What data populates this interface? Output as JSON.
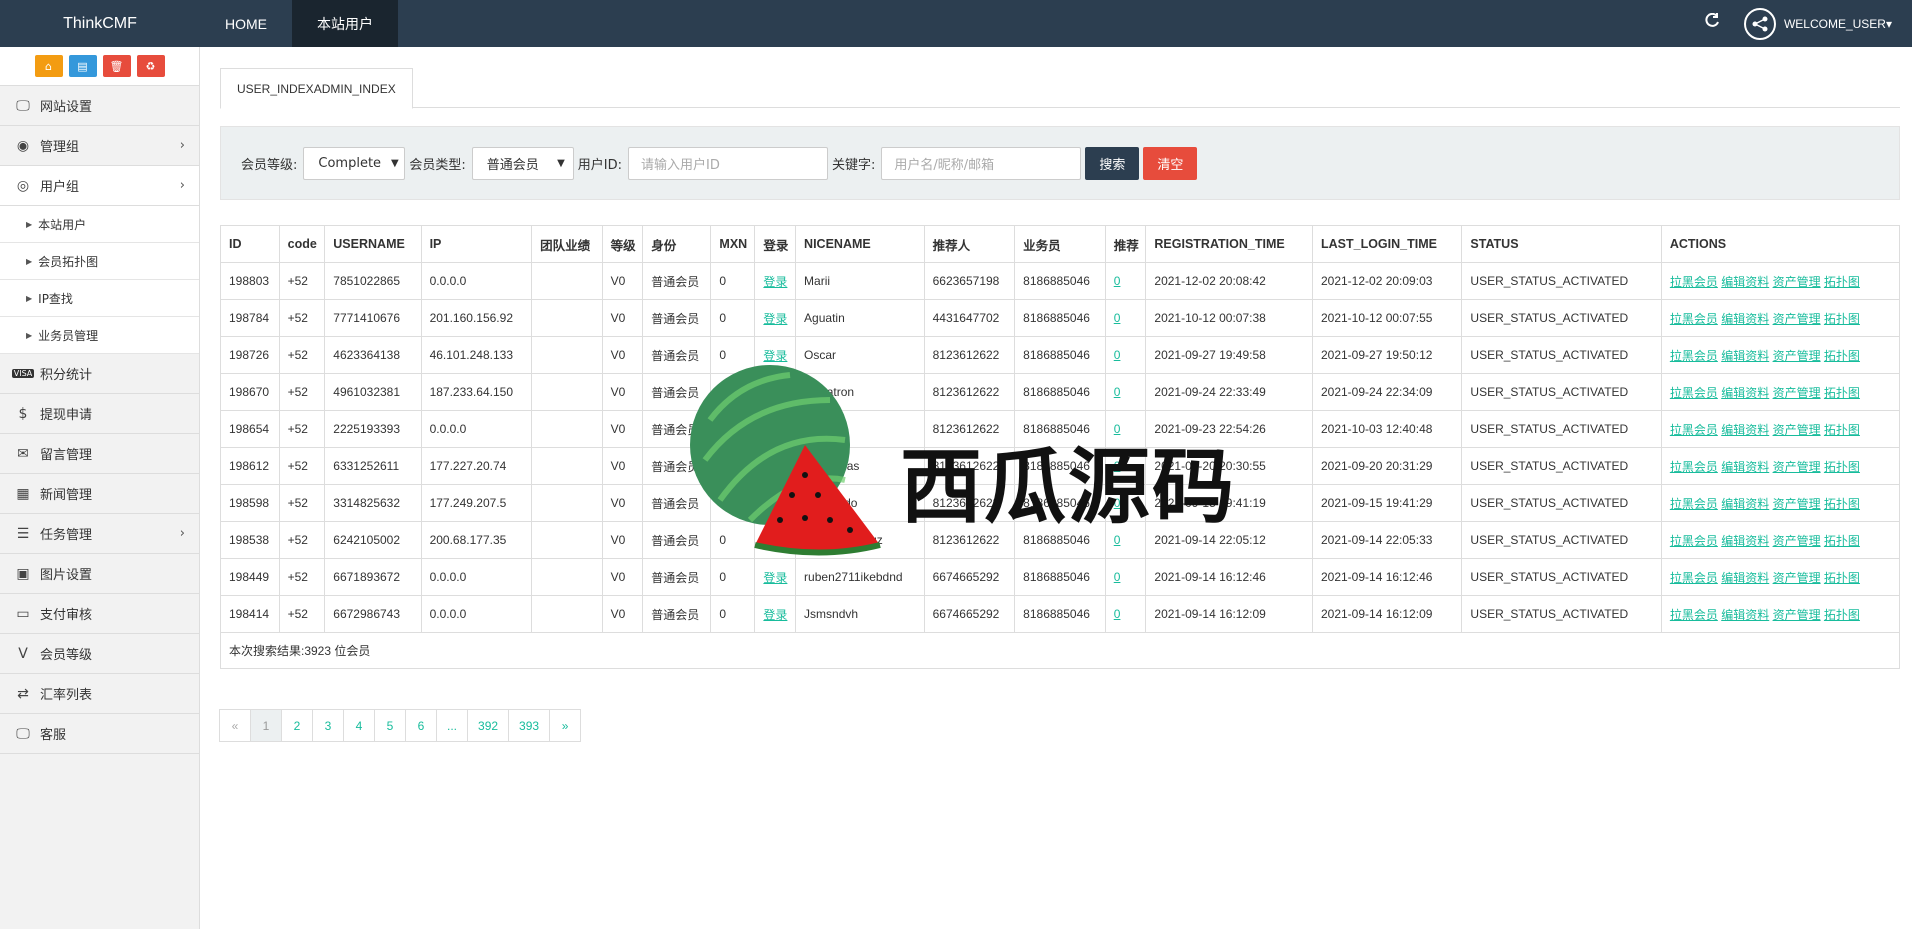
{
  "topbar": {
    "brand": "ThinkCMF",
    "nav": [
      {
        "label": "HOME",
        "active": false
      },
      {
        "label": "本站用户",
        "active": true
      }
    ],
    "refresh_icon": "refresh-icon",
    "welcome": "WELCOME_USER▾"
  },
  "sidebar": {
    "quick": [
      "home-icon",
      "file-icon",
      "trash-icon",
      "recycle-icon"
    ],
    "items": [
      {
        "label": "网站设置",
        "icon": "monitor-icon"
      },
      {
        "label": "管理组",
        "icon": "user-circle-icon",
        "chevron": true
      },
      {
        "label": "用户组",
        "icon": "user-outline-icon",
        "chevron": true,
        "open": true
      },
      {
        "label": "积分统计",
        "icon": "visa-icon"
      },
      {
        "label": "提现申请",
        "icon": "dollar-icon"
      },
      {
        "label": "留言管理",
        "icon": "envelope-icon"
      },
      {
        "label": "新闻管理",
        "icon": "newspaper-icon"
      },
      {
        "label": "任务管理",
        "icon": "tasks-icon",
        "chevron": true
      },
      {
        "label": "图片设置",
        "icon": "image-icon"
      },
      {
        "label": "支付审核",
        "icon": "id-card-icon"
      },
      {
        "label": "会员等级",
        "icon": "vine-icon"
      },
      {
        "label": "汇率列表",
        "icon": "exchange-icon"
      },
      {
        "label": "客服",
        "icon": "desktop-icon"
      }
    ],
    "subitems": [
      "本站用户",
      "会员拓扑图",
      "IP查找",
      "业务员管理"
    ]
  },
  "main": {
    "tab": "USER_INDEXADMIN_INDEX",
    "filter": {
      "level_label": "会员等级:",
      "level_value": "Complete",
      "type_label": "会员类型:",
      "type_value": "普通会员",
      "uid_label": "用户ID:",
      "uid_placeholder": "请输入用户ID",
      "keyword_label": "关键字:",
      "keyword_placeholder": "用户名/昵称/邮箱",
      "search_btn": "搜索",
      "clear_btn": "清空"
    },
    "table": {
      "headers": [
        "ID",
        "code",
        "USERNAME",
        "IP",
        "团队业绩",
        "等级",
        "身份",
        "MXN",
        "登录",
        "NICENAME",
        "推荐人",
        "业务员",
        "推荐",
        "REGISTRATION_TIME",
        "LAST_LOGIN_TIME",
        "STATUS",
        "ACTIONS"
      ],
      "rows": [
        [
          "198803",
          "+52",
          "7851022865",
          "0.0.0.0",
          "",
          "V0",
          "普通会员",
          "0",
          "登录",
          "Marii",
          "6623657198",
          "8186885046",
          "0",
          "2021-12-02 20:08:42",
          "2021-12-02 20:09:03",
          "USER_STATUS_ACTIVATED"
        ],
        [
          "198784",
          "+52",
          "7771410676",
          "201.160.156.92",
          "",
          "V0",
          "普通会员",
          "0",
          "登录",
          "Aguatin",
          "4431647702",
          "8186885046",
          "0",
          "2021-10-12 00:07:38",
          "2021-10-12 00:07:55",
          "USER_STATUS_ACTIVATED"
        ],
        [
          "198726",
          "+52",
          "4623364138",
          "46.101.248.133",
          "",
          "V0",
          "普通会员",
          "0",
          "登录",
          "Oscar",
          "8123612622",
          "8186885046",
          "0",
          "2021-09-27 19:49:58",
          "2021-09-27 19:50:12",
          "USER_STATUS_ACTIVATED"
        ],
        [
          "198670",
          "+52",
          "4961032381",
          "187.233.64.150",
          "",
          "V0",
          "普通会员",
          "0",
          "登录",
          "Jamatron",
          "8123612622",
          "8186885046",
          "0",
          "2021-09-24 22:33:49",
          "2021-09-24 22:34:09",
          "USER_STATUS_ACTIVATED"
        ],
        [
          "198654",
          "+52",
          "2225193393",
          "0.0.0.0",
          "",
          "V0",
          "普通会员",
          "0",
          "登录",
          "l ha",
          "8123612622",
          "8186885046",
          "0",
          "2021-09-23 22:54:26",
          "2021-10-03 12:40:48",
          "USER_STATUS_ACTIVATED"
        ],
        [
          "198612",
          "+52",
          "6331252611",
          "177.227.20.74",
          "",
          "V0",
          "普通会员",
          "0",
          "登录",
          "an Cudras",
          "8123612622",
          "8186885046",
          "0",
          "2021-09-20 20:30:55",
          "2021-09-20 20:31:29",
          "USER_STATUS_ACTIVATED"
        ],
        [
          "198598",
          "+52",
          "3314825632",
          "177.249.207.5",
          "",
          "V0",
          "普通会员",
          "0",
          "登录",
          "Escobedo",
          "8123612622",
          "8186885046",
          "0",
          "2021-09-15 19:41:19",
          "2021-09-15 19:41:29",
          "USER_STATUS_ACTIVATED"
        ],
        [
          "198538",
          "+52",
          "6242105002",
          "200.68.177.35",
          "",
          "V0",
          "普通会员",
          "0",
          "登录",
          "vera de la cruz",
          "8123612622",
          "8186885046",
          "0",
          "2021-09-14 22:05:12",
          "2021-09-14 22:05:33",
          "USER_STATUS_ACTIVATED"
        ],
        [
          "198449",
          "+52",
          "6671893672",
          "0.0.0.0",
          "",
          "V0",
          "普通会员",
          "0",
          "登录",
          "ruben2711ikebdnd",
          "6674665292",
          "8186885046",
          "0",
          "2021-09-14 16:12:46",
          "2021-09-14 16:12:46",
          "USER_STATUS_ACTIVATED"
        ],
        [
          "198414",
          "+52",
          "6672986743",
          "0.0.0.0",
          "",
          "V0",
          "普通会员",
          "0",
          "登录",
          "Jsmsndvh",
          "6674665292",
          "8186885046",
          "0",
          "2021-09-14 16:12:09",
          "2021-09-14 16:12:09",
          "USER_STATUS_ACTIVATED"
        ]
      ],
      "actions": [
        "拉黑会员",
        "编辑资料",
        "资产管理",
        "拓扑图"
      ],
      "summary": "本次搜索结果:3923 位会员"
    },
    "pagination": [
      "«",
      "1",
      "2",
      "3",
      "4",
      "5",
      "6",
      "...",
      "392",
      "393",
      "»"
    ]
  },
  "watermark": {
    "text": "西瓜源码",
    "icon": "watermelon-icon"
  }
}
